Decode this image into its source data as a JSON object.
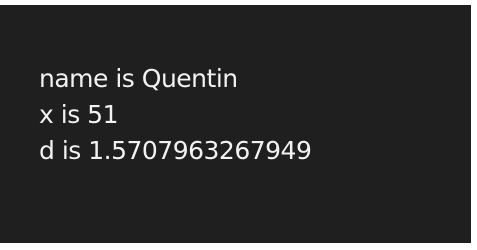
{
  "console": {
    "lines": [
      "name is Quentin",
      "x is 51",
      "d is 1.5707963267949"
    ]
  }
}
